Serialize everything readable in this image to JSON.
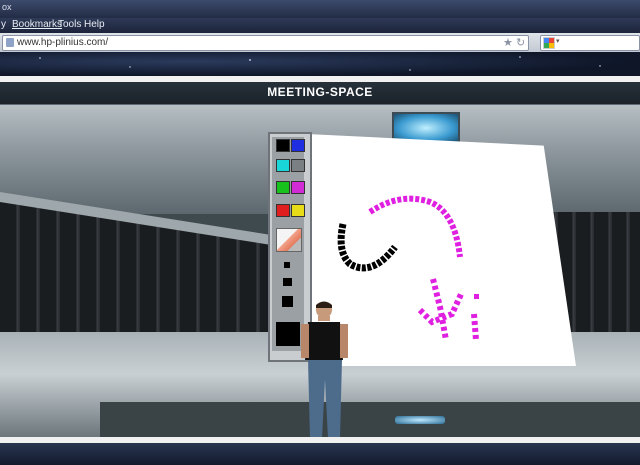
{
  "window": {
    "title_fragment": "ox"
  },
  "menu": {
    "items": [
      "y",
      "Bookmarks",
      "Tools",
      "Help"
    ]
  },
  "navbar": {
    "url": "www.hp-plinius.com/",
    "star_icon": "star-icon",
    "reload_icon": "reload-icon",
    "search_engine_icon": "google-icon"
  },
  "scene": {
    "banner_title": "MEETING-SPACE"
  },
  "palette": {
    "colors": [
      [
        "#000000",
        "#1e2ee0"
      ],
      [
        "#19d7d9",
        "#7a7f83"
      ],
      [
        "#18c21c",
        "#d12bd6"
      ],
      [
        "#e01e1e",
        "#e8dc18"
      ]
    ],
    "tools": [
      "eraser-icon",
      "pen-size-small",
      "pen-size-medium",
      "pen-size-large",
      "pen-size-xlarge"
    ]
  },
  "colors": {
    "stroke_black": "#000000",
    "stroke_magenta": "#e020e0"
  }
}
